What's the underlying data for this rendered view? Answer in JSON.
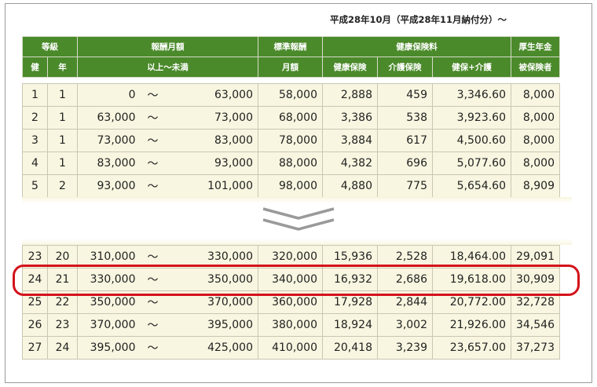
{
  "caption": "平成28年10月（平成28年11月納付分）〜",
  "header": {
    "row1": {
      "grade": "等級",
      "monthly_pay": "報酬月額",
      "standard_pay": "標準報酬",
      "health_ins": "健康保険料",
      "pension": "厚生年金"
    },
    "row2": {
      "ken": "健",
      "nen": "年",
      "range": "以上〜未満",
      "monthly": "月額",
      "health": "健康保険",
      "care": "介護保険",
      "health_care": "健保+介護",
      "insured": "被保険者"
    }
  },
  "top_rows": [
    {
      "ken": "1",
      "nen": "1",
      "low": "0",
      "tilde": "〜",
      "high": "63,000",
      "standard": "58,000",
      "health": "2,888",
      "care": "459",
      "health_care": "3,346.60",
      "pension": "8,000"
    },
    {
      "ken": "2",
      "nen": "1",
      "low": "63,000",
      "tilde": "〜",
      "high": "73,000",
      "standard": "68,000",
      "health": "3,386",
      "care": "538",
      "health_care": "3,923.60",
      "pension": "8,000"
    },
    {
      "ken": "3",
      "nen": "1",
      "low": "73,000",
      "tilde": "〜",
      "high": "83,000",
      "standard": "78,000",
      "health": "3,884",
      "care": "617",
      "health_care": "4,500.60",
      "pension": "8,000"
    },
    {
      "ken": "4",
      "nen": "1",
      "low": "83,000",
      "tilde": "〜",
      "high": "93,000",
      "standard": "88,000",
      "health": "4,382",
      "care": "696",
      "health_care": "5,077.60",
      "pension": "8,000"
    },
    {
      "ken": "5",
      "nen": "2",
      "low": "93,000",
      "tilde": "〜",
      "high": "101,000",
      "standard": "98,000",
      "health": "4,880",
      "care": "775",
      "health_care": "5,654.60",
      "pension": "8,909"
    }
  ],
  "bottom_rows": [
    {
      "ken": "23",
      "nen": "20",
      "low": "310,000",
      "tilde": "〜",
      "high": "330,000",
      "standard": "320,000",
      "health": "15,936",
      "care": "2,528",
      "health_care": "18,464.00",
      "pension": "29,091"
    },
    {
      "ken": "24",
      "nen": "21",
      "low": "330,000",
      "tilde": "〜",
      "high": "350,000",
      "standard": "340,000",
      "health": "16,932",
      "care": "2,686",
      "health_care": "19,618.00",
      "pension": "30,909"
    },
    {
      "ken": "25",
      "nen": "22",
      "low": "350,000",
      "tilde": "〜",
      "high": "370,000",
      "standard": "360,000",
      "health": "17,928",
      "care": "2,844",
      "health_care": "20,772.00",
      "pension": "32,728"
    },
    {
      "ken": "26",
      "nen": "23",
      "low": "370,000",
      "tilde": "〜",
      "high": "395,000",
      "standard": "380,000",
      "health": "18,924",
      "care": "3,002",
      "health_care": "21,926.00",
      "pension": "34,546"
    },
    {
      "ken": "27",
      "nen": "24",
      "low": "395,000",
      "tilde": "〜",
      "high": "425,000",
      "standard": "410,000",
      "health": "20,418",
      "care": "3,239",
      "health_care": "23,657.00",
      "pension": "37,273"
    }
  ],
  "highlighted_row": "24",
  "colors": {
    "header_bg": "#4b8a2b",
    "row_bg": "#f8f6e0",
    "highlight": "#d4121a",
    "chevron": "#9a9a9a"
  },
  "icons": {
    "separator": "double-chevron-down-icon"
  }
}
